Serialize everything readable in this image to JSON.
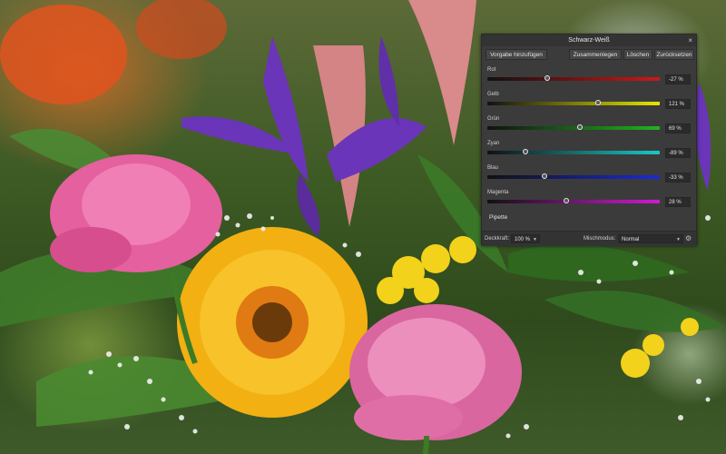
{
  "panel": {
    "title": "Schwarz-Weiß",
    "close_icon": "×",
    "buttons": {
      "preset": "Vorgabe hinzufügen",
      "merge": "Zusammenlegen",
      "delete": "Löschen",
      "reset": "Zurücksetzen"
    },
    "sliders": [
      {
        "label": "Rot",
        "value_text": "-27 %",
        "percent": -27,
        "track_color": "#d11616"
      },
      {
        "label": "Gelb",
        "value_text": "121 %",
        "percent": 121,
        "track_color": "#e6e600"
      },
      {
        "label": "Grün",
        "value_text": "69 %",
        "percent": 69,
        "track_color": "#1fb51f"
      },
      {
        "label": "Zyan",
        "value_text": "-89 %",
        "percent": -89,
        "track_color": "#19c8c8"
      },
      {
        "label": "Blau",
        "value_text": "-33 %",
        "percent": -33,
        "track_color": "#1a2ad6"
      },
      {
        "label": "Magenta",
        "value_text": "28 %",
        "percent": 28,
        "track_color": "#d11ad1"
      }
    ],
    "pipette": "Pipette",
    "footer": {
      "opacity_label": "Deckkraft:",
      "opacity_value": "100 %",
      "blend_label": "Mischmodus:",
      "blend_value": "Normal"
    }
  }
}
